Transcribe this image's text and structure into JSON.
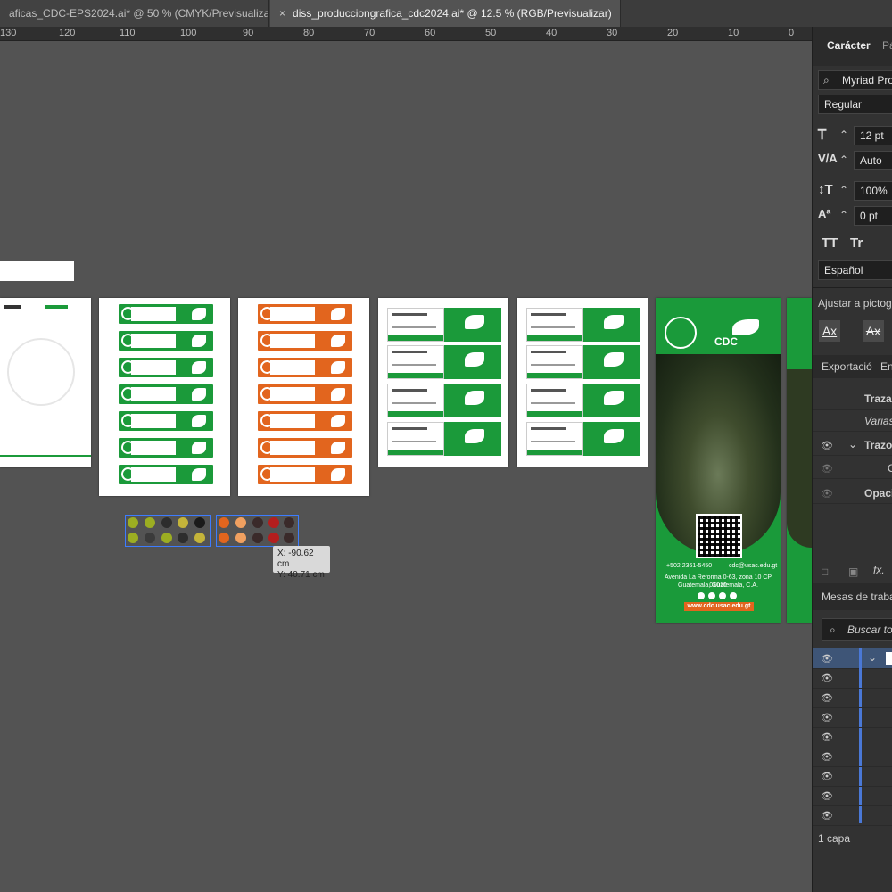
{
  "tabs": [
    {
      "label": "aficas_CDC-EPS2024.ai* @ 50 % (CMYK/Previsualizar)",
      "close": "×"
    },
    {
      "label": "diss_producciongrafica_cdc2024.ai* @ 12.5 % (RGB/Previsualizar)",
      "close": "×"
    }
  ],
  "ruler": [
    "130",
    "120",
    "110",
    "100",
    "90",
    "80",
    "70",
    "60",
    "50",
    "40",
    "30",
    "20",
    "10",
    "0"
  ],
  "canvas": {
    "cursor_tooltip": {
      "x": "X: -90.62 cm",
      "y": "Y: 40.71 cm"
    },
    "banner": {
      "phone": "+502 2361-5450",
      "email": "cdc@usac.edu.gt",
      "address1": "Avenida La Reforma 0-63, zona 10 CP 01010",
      "address2": "Guatemala, Guatemala, C.A.",
      "url": "www.cdc.usac.edu.gt",
      "logo_text": "CDC"
    }
  },
  "panel": {
    "tab_character": "Carácter",
    "tab_paragraph": "Pá",
    "font_family": "Myriad Pro",
    "font_style": "Regular",
    "font_size": "12 pt",
    "kerning": "Auto",
    "scale": "100%",
    "baseline": "0 pt",
    "tt_label": "TT",
    "tr_label": "Tr",
    "language": "Español",
    "snap_label": "Ajustar a pictogr",
    "export_tab": "Exportació",
    "export_tab2": "En",
    "appearance_title": "Traza",
    "appearance_sub": "Varias",
    "appearance_stroke": "Trazo",
    "appearance_o": "O",
    "appearance_opacity": "Opaci",
    "fx_label": "fx.",
    "artboards_title": "Mesas de traba",
    "search_placeholder": "Buscar to",
    "layers_count": "1 capa"
  },
  "colors": {
    "green": "#1b9a3a",
    "orange": "#e2651e",
    "selection": "#3d7cff"
  },
  "swatches_left": [
    "#9cae22",
    "#9cae22",
    "#2d2d2d",
    "#c4b43a",
    "#2d2d2d",
    "#1a1a1a",
    "#9cae22",
    "#3b3b3b",
    "#9cae22",
    "#2d2d2d",
    "#c4b43a",
    "#1a1a1a"
  ],
  "swatches_right": [
    "#e2651e",
    "#f0a060",
    "#3a2a2a",
    "#b41e1e",
    "#3a2a2a",
    "#e2651e",
    "#f0a060",
    "#3a2a2a",
    "#b41e1e",
    "#3a2a2a"
  ]
}
